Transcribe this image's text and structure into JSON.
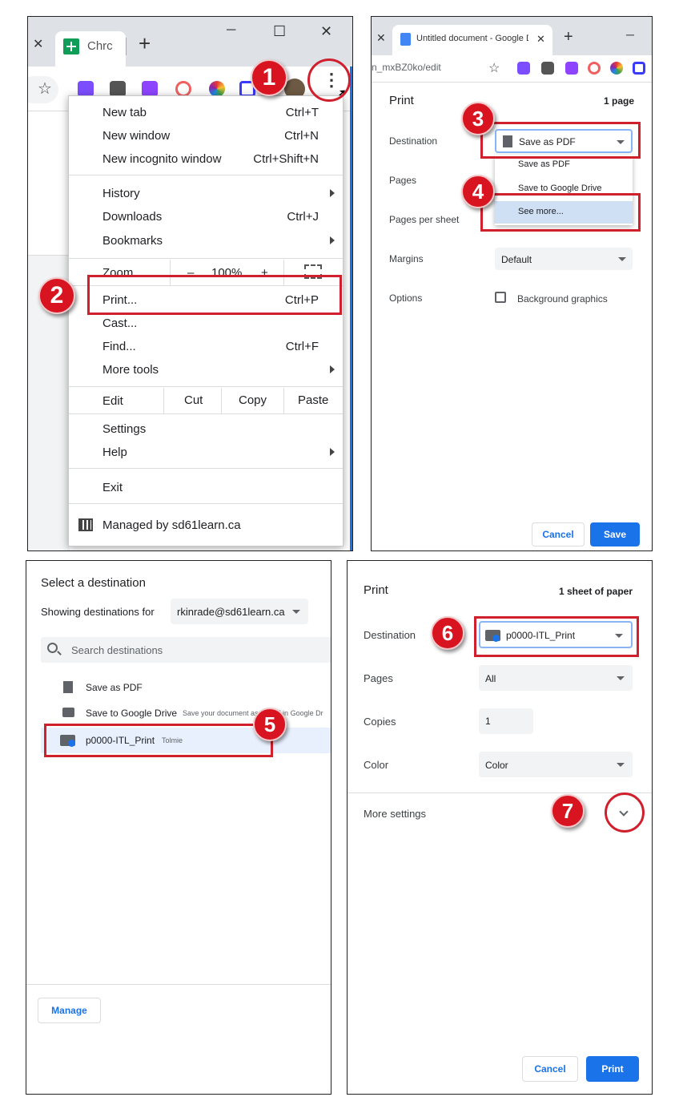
{
  "panel1": {
    "tab_title": "Chrc",
    "new_tab_symbol": "+",
    "window_controls": {
      "minimize": "─",
      "maximize": "☐",
      "close": "✕"
    },
    "tab_close": "✕",
    "menu": {
      "new_tab": {
        "label": "New tab",
        "shortcut": "Ctrl+T"
      },
      "new_window": {
        "label": "New window",
        "shortcut": "Ctrl+N"
      },
      "new_incognito": {
        "label": "New incognito window",
        "shortcut": "Ctrl+Shift+N"
      },
      "history": {
        "label": "History"
      },
      "downloads": {
        "label": "Downloads",
        "shortcut": "Ctrl+J"
      },
      "bookmarks": {
        "label": "Bookmarks"
      },
      "zoom": {
        "label": "Zoom",
        "minus": "–",
        "value": "100%",
        "plus": "+"
      },
      "print": {
        "label": "Print...",
        "shortcut": "Ctrl+P"
      },
      "cast": {
        "label": "Cast..."
      },
      "find": {
        "label": "Find...",
        "shortcut": "Ctrl+F"
      },
      "more_tools": {
        "label": "More tools"
      },
      "edit": {
        "label": "Edit",
        "cut": "Cut",
        "copy": "Copy",
        "paste": "Paste"
      },
      "settings": {
        "label": "Settings"
      },
      "help": {
        "label": "Help"
      },
      "exit": {
        "label": "Exit"
      },
      "managed": {
        "label": "Managed by sd61learn.ca"
      }
    },
    "badges": {
      "b1": "1",
      "b2": "2"
    }
  },
  "panel2": {
    "tab_title": "Untitled document - Google Do",
    "url_fragment": "n_mxBZ0ko/edit",
    "title": "Print",
    "page_count": "1 page",
    "destination_label": "Destination",
    "destination_value": "Save as PDF",
    "dropdown_options": [
      "Save as PDF",
      "Save to Google Drive",
      "See more..."
    ],
    "pages_label": "Pages",
    "pages_per_sheet_label": "Pages per sheet",
    "margins_label": "Margins",
    "margins_value": "Default",
    "options_label": "Options",
    "background_graphics": "Background graphics",
    "cancel": "Cancel",
    "save": "Save",
    "badges": {
      "b3": "3",
      "b4": "4"
    }
  },
  "panel3": {
    "title": "Select a destination",
    "showing_for": "Showing destinations for",
    "account": "rkinrade@sd61learn.ca",
    "search_placeholder": "Search destinations",
    "destinations": [
      {
        "name": "Save as PDF",
        "note": ""
      },
      {
        "name": "Save to Google Drive",
        "note": "Save your document as a PDF in Google Dr"
      },
      {
        "name": "p0000-ITL_Print",
        "note": "Tolmie"
      }
    ],
    "manage": "Manage",
    "badges": {
      "b5": "5"
    }
  },
  "panel4": {
    "title": "Print",
    "sheet_count": "1 sheet of paper",
    "destination_label": "Destination",
    "destination_value": "p0000-ITL_Print",
    "pages_label": "Pages",
    "pages_value": "All",
    "copies_label": "Copies",
    "copies_value": "1",
    "color_label": "Color",
    "color_value": "Color",
    "more_settings": "More settings",
    "cancel": "Cancel",
    "print": "Print",
    "badges": {
      "b6": "6",
      "b7": "7"
    }
  },
  "colors": {
    "accent_red": "#d0202e",
    "badge_red": "#d7141f",
    "primary_blue": "#1a73e8"
  },
  "icons": [
    "close-icon",
    "sheets-icon",
    "plus-icon",
    "star-icon",
    "kebab-icon",
    "cursor-icon",
    "fullscreen-icon",
    "building-icon",
    "docs-icon",
    "file-icon",
    "drive-icon",
    "printer-icon",
    "search-icon",
    "chevron-down-icon",
    "checkbox-icon"
  ]
}
